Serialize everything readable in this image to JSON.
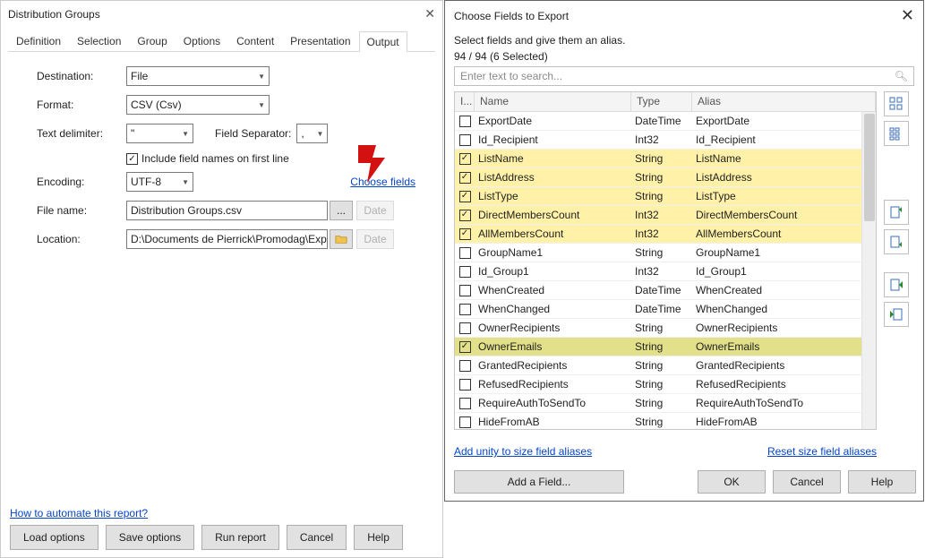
{
  "leftDialog": {
    "title": "Distribution Groups",
    "tabs": [
      "Definition",
      "Selection",
      "Group",
      "Options",
      "Content",
      "Presentation",
      "Output"
    ],
    "activeTab": "Output",
    "labels": {
      "destination": "Destination:",
      "format": "Format:",
      "textDelimiter": "Text delimiter:",
      "fieldSeparator": "Field Separator:",
      "include": "Include field names on first line",
      "encoding": "Encoding:",
      "chooseFields": "Choose fields",
      "fileName": "File name:",
      "location": "Location:",
      "date": "Date",
      "automate": "How to automate this report?"
    },
    "values": {
      "destination": "File",
      "format": "CSV (Csv)",
      "textDelimiter": "\"",
      "fieldSeparator": ",",
      "encoding": "UTF-8",
      "fileName": "Distribution Groups.csv",
      "location": "D:\\Documents de Pierrick\\Promodag\\Exp"
    },
    "buttons": {
      "loadOptions": "Load options",
      "saveOptions": "Save options",
      "runReport": "Run report",
      "cancel": "Cancel",
      "help": "Help"
    }
  },
  "rightDialog": {
    "title": "Choose Fields to Export",
    "desc": "Select fields and give them an alias.",
    "count": "94 / 94 (6 Selected)",
    "searchPlaceholder": "Enter text to search...",
    "headers": {
      "i": "I...",
      "name": "Name",
      "type": "Type",
      "alias": "Alias"
    },
    "rows": [
      {
        "checked": false,
        "name": "ExportDate",
        "type": "DateTime",
        "alias": "ExportDate",
        "hl": ""
      },
      {
        "checked": false,
        "name": "Id_Recipient",
        "type": "Int32",
        "alias": "Id_Recipient",
        "hl": ""
      },
      {
        "checked": true,
        "name": "ListName",
        "type": "String",
        "alias": "ListName",
        "hl": "sel"
      },
      {
        "checked": true,
        "name": "ListAddress",
        "type": "String",
        "alias": "ListAddress",
        "hl": "sel"
      },
      {
        "checked": true,
        "name": "ListType",
        "type": "String",
        "alias": "ListType",
        "hl": "sel"
      },
      {
        "checked": true,
        "name": "DirectMembersCount",
        "type": "Int32",
        "alias": "DirectMembersCount",
        "hl": "sel"
      },
      {
        "checked": true,
        "name": "AllMembersCount",
        "type": "Int32",
        "alias": "AllMembersCount",
        "hl": "sel"
      },
      {
        "checked": false,
        "name": "GroupName1",
        "type": "String",
        "alias": "GroupName1",
        "hl": ""
      },
      {
        "checked": false,
        "name": "Id_Group1",
        "type": "Int32",
        "alias": "Id_Group1",
        "hl": ""
      },
      {
        "checked": false,
        "name": "WhenCreated",
        "type": "DateTime",
        "alias": "WhenCreated",
        "hl": ""
      },
      {
        "checked": false,
        "name": "WhenChanged",
        "type": "DateTime",
        "alias": "WhenChanged",
        "hl": ""
      },
      {
        "checked": false,
        "name": "OwnerRecipients",
        "type": "String",
        "alias": "OwnerRecipients",
        "hl": ""
      },
      {
        "checked": true,
        "name": "OwnerEmails",
        "type": "String",
        "alias": "OwnerEmails",
        "hl": "sel2"
      },
      {
        "checked": false,
        "name": "GrantedRecipients",
        "type": "String",
        "alias": "GrantedRecipients",
        "hl": ""
      },
      {
        "checked": false,
        "name": "RefusedRecipients",
        "type": "String",
        "alias": "RefusedRecipients",
        "hl": ""
      },
      {
        "checked": false,
        "name": "RequireAuthToSendTo",
        "type": "String",
        "alias": "RequireAuthToSendTo",
        "hl": ""
      },
      {
        "checked": false,
        "name": "HideFromAB",
        "type": "String",
        "alias": "HideFromAB",
        "hl": ""
      }
    ],
    "links": {
      "addUnity": "Add unity to size field aliases",
      "reset": "Reset size field aliases"
    },
    "buttons": {
      "addField": "Add a Field...",
      "ok": "OK",
      "cancel": "Cancel",
      "help": "Help"
    }
  }
}
